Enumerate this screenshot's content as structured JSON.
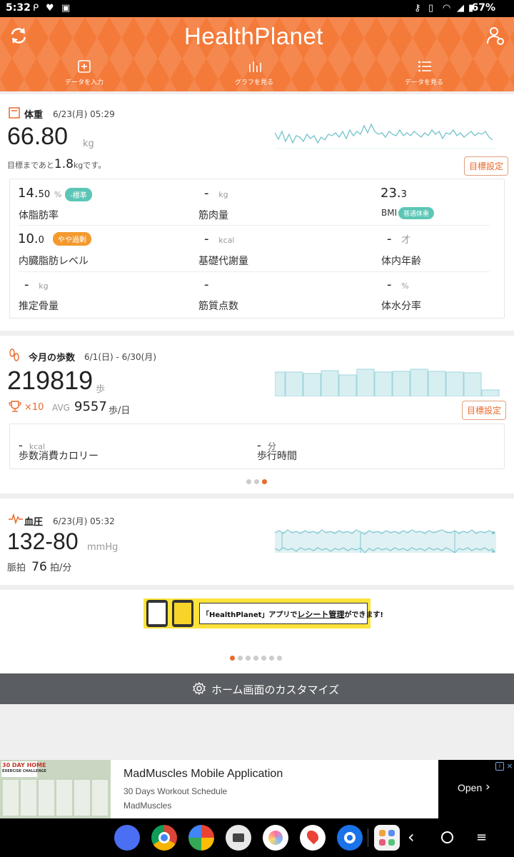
{
  "status": {
    "time": "5:32",
    "battery": "67%"
  },
  "header": {
    "logo": "HealthPlanet",
    "nav": [
      {
        "label": "データを入力",
        "icon": "plus-square-icon"
      },
      {
        "label": "グラフを見る",
        "icon": "bar-chart-icon"
      },
      {
        "label": "データを見る",
        "icon": "list-icon"
      }
    ]
  },
  "weight": {
    "title": "体重",
    "date": "6/23(月) 05:29",
    "value": "66.80",
    "unit": "kg",
    "goal_prefix": "目標まであと",
    "goal_value": "1.8",
    "goal_unit": "kg",
    "goal_suffix": "です。",
    "goal_button": "目標設定",
    "metrics": [
      {
        "value_main": "14.",
        "value_frac": "50",
        "unit": "%",
        "label": "体脂肪率",
        "badge": "-標準",
        "badge_color": "#5cc6b6"
      },
      {
        "value_main": "-",
        "value_frac": "",
        "unit": "kg",
        "label": "筋肉量"
      },
      {
        "value_main": "23.",
        "value_frac": "3",
        "unit": "",
        "label": "BMI",
        "badge": "普通体重",
        "badge_color": "#5cc6b6"
      },
      {
        "value_main": "10.",
        "value_frac": "0",
        "unit": "",
        "label": "内臓脂肪レベル",
        "badge": "やや過剰",
        "badge_color": "#f39a2e"
      },
      {
        "value_main": "-",
        "value_frac": "",
        "unit": "kcal",
        "label": "基礎代謝量"
      },
      {
        "value_main": "-",
        "value_frac": "",
        "unit": "才",
        "label": "体内年齢"
      },
      {
        "value_main": "-",
        "value_frac": "",
        "unit": "kg",
        "label": "推定骨量"
      },
      {
        "value_main": "-",
        "value_frac": "",
        "unit": "",
        "label": "筋質点数"
      },
      {
        "value_main": "-",
        "value_frac": "",
        "unit": "%",
        "label": "体水分率"
      }
    ]
  },
  "steps": {
    "title": "今月の歩数",
    "range": "6/1(日) - 6/30(月)",
    "value": "219819",
    "unit": "歩",
    "trophy": "×10",
    "avg_label": "AVG",
    "avg_value": "9557",
    "avg_unit": "歩/日",
    "goal_button": "目標設定",
    "calorie_value": "-",
    "calorie_unit": "kcal",
    "calorie_label": "歩数消費カロリー",
    "time_value": "-",
    "time_unit": "分",
    "time_label": "歩行時間"
  },
  "bp": {
    "title": "血圧",
    "date": "6/23(月) 05:32",
    "value": "132-80",
    "unit": "mmHg",
    "pulse_label": "脈拍",
    "pulse_value": "76",
    "pulse_unit": "拍/分"
  },
  "banner": {
    "text_prefix": "「HealthPlanet」アプリで",
    "text_highlight": "レシート管理",
    "text_suffix": "ができます!"
  },
  "customize": {
    "label": "ホーム画面のカスタマイズ"
  },
  "ad": {
    "thumb_title": "30 DAY HOME",
    "thumb_sub": "EXERCISE CHALLENGE",
    "title": "MadMuscles Mobile Application",
    "subtitle": "30 Days Workout Schedule",
    "brand": "MadMuscles",
    "cta": "Open"
  }
}
